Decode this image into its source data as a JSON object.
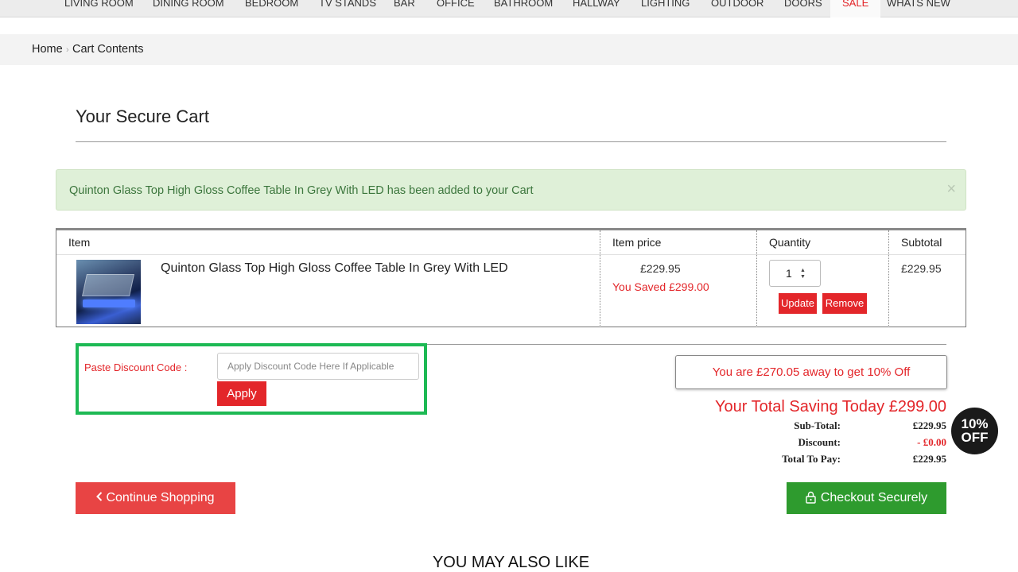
{
  "nav": {
    "items": [
      "LIVING ROOM",
      "DINING ROOM",
      "BEDROOM",
      "TV STANDS",
      "BAR",
      "OFFICE",
      "BATHROOM",
      "HALLWAY",
      "LIGHTING",
      "OUTDOOR",
      "DOORS",
      "SALE",
      "WHATS NEW"
    ]
  },
  "breadcrumb": {
    "home": "Home",
    "separator": "›",
    "current": "Cart Contents"
  },
  "page": {
    "title": "Your Secure Cart"
  },
  "alert": {
    "message": "Quinton Glass Top High Gloss Coffee Table In Grey With LED has been added to your Cart",
    "close": "×"
  },
  "cart": {
    "headers": {
      "item": "Item",
      "price": "Item price",
      "quantity": "Quantity",
      "subtotal": "Subtotal"
    },
    "rows": [
      {
        "name": "Quinton Glass Top High Gloss Coffee Table In Grey With LED",
        "price": "£229.95",
        "saved": "You Saved £299.00",
        "quantity": "1",
        "update_label": "Update",
        "remove_label": "Remove",
        "subtotal": "£229.95"
      }
    ]
  },
  "discount": {
    "label": "Paste Discount Code :",
    "placeholder": "Apply Discount Code Here If Applicable",
    "apply_label": "Apply"
  },
  "summary": {
    "away_message": "You are £270.05 away to get 10% Off",
    "total_saving": "Your Total Saving Today £299.00",
    "rows": [
      {
        "label": "Sub-Total:",
        "value": "£229.95"
      },
      {
        "label": "Discount:",
        "value": "- £0.00"
      },
      {
        "label": "Total To Pay:",
        "value": "£229.95"
      }
    ]
  },
  "badge": {
    "line1": "10%",
    "line2": "OFF"
  },
  "actions": {
    "continue_label": "Continue Shopping",
    "continue_icon": "chevron-left-icon",
    "checkout_label": "Checkout Securely",
    "checkout_icon": "lock-icon"
  },
  "also_like": {
    "title": "YOU MAY ALSO LIKE"
  },
  "colors": {
    "accent_red": "#e3262a",
    "checkout_green": "#2e9b2e",
    "highlight_green": "#1db954",
    "alert_bg": "#dff0d8"
  }
}
